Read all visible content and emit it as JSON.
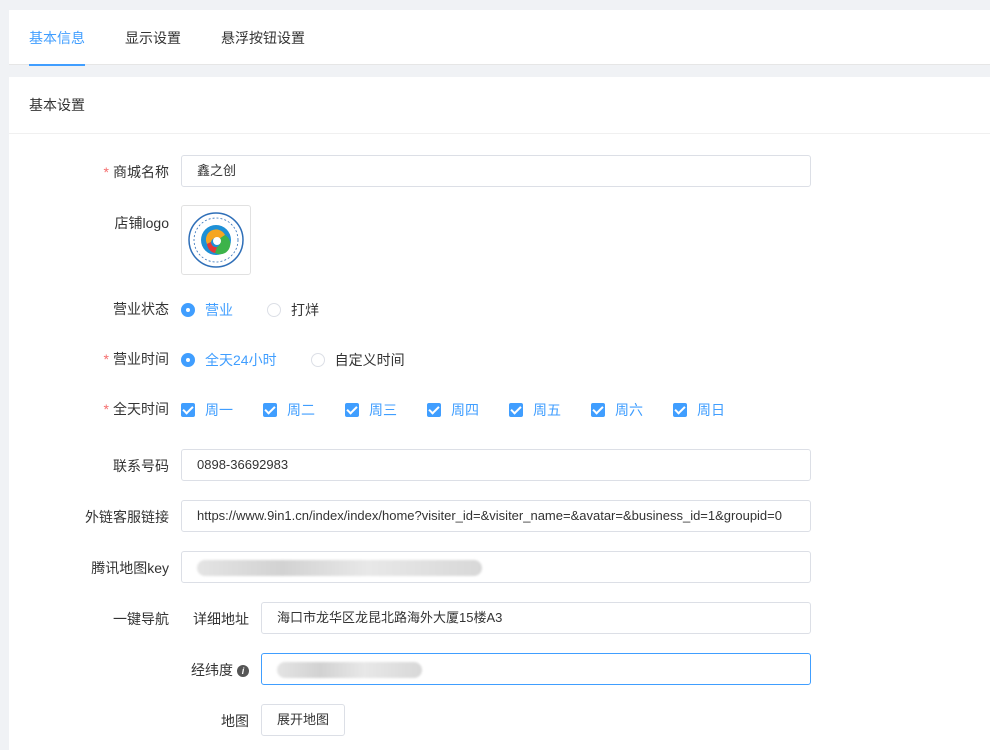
{
  "tabs": [
    {
      "label": "基本信息",
      "active": true
    },
    {
      "label": "显示设置",
      "active": false
    },
    {
      "label": "悬浮按钮设置",
      "active": false
    }
  ],
  "section_title": "基本设置",
  "form": {
    "shop_name": {
      "label": "商城名称",
      "required": true,
      "value": "鑫之创"
    },
    "logo": {
      "label": "店铺logo"
    },
    "business_status": {
      "label": "营业状态",
      "options": [
        "营业",
        "打烊"
      ],
      "selected": "营业"
    },
    "business_hours": {
      "label": "营业时间",
      "required": true,
      "options": [
        "全天24小时",
        "自定义时间"
      ],
      "selected": "全天24小时"
    },
    "all_day": {
      "label": "全天时间",
      "required": true,
      "days": [
        "周一",
        "周二",
        "周三",
        "周四",
        "周五",
        "周六",
        "周日"
      ]
    },
    "phone": {
      "label": "联系号码",
      "value": "0898-36692983"
    },
    "service_link": {
      "label": "外链客服链接",
      "value": "https://www.9in1.cn/index/index/home?visiter_id=&visiter_name=&avatar=&business_id=1&groupid=0"
    },
    "map_key": {
      "label": "腾讯地图key"
    },
    "navigation": {
      "label": "一键导航",
      "address_label": "详细地址",
      "address_value": "海口市龙华区龙昆北路海外大厦15楼A3",
      "latlng_label": "经纬度",
      "map_label": "地图",
      "map_button": "展开地图"
    }
  },
  "colors": {
    "accent": "#409eff",
    "required": "#f56c6c"
  }
}
